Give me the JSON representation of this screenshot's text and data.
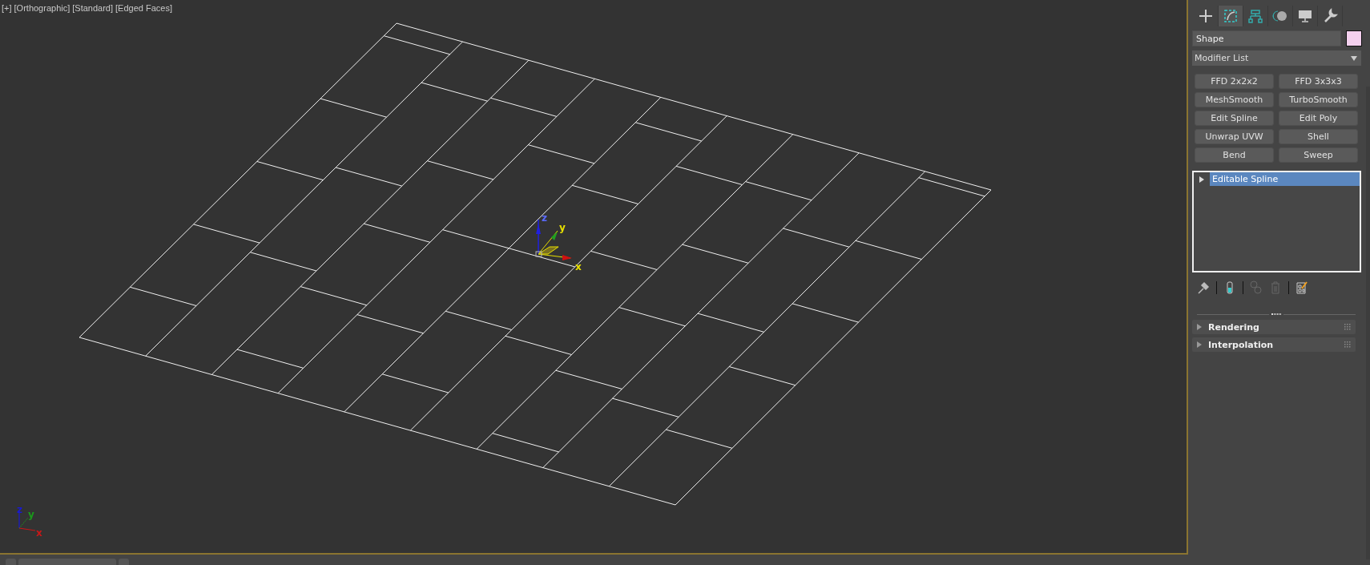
{
  "viewport": {
    "labels": [
      {
        "text": "[+]"
      },
      {
        "text": "[Orthographic]"
      },
      {
        "text": "[Standard]"
      },
      {
        "text": "[Edged Faces]"
      }
    ],
    "gizmo_axes": [
      {
        "label": "z",
        "color": "#5a6aff"
      },
      {
        "label": "y",
        "color": "#e8e000"
      },
      {
        "label": "x",
        "color": "#e8e000"
      }
    ],
    "corner_axes": [
      {
        "label": "z",
        "color": "#1a1ad0"
      },
      {
        "label": "y",
        "color": "#1a9a1a"
      },
      {
        "label": "x",
        "color": "#c81818"
      }
    ]
  },
  "command_panel": {
    "tabs": [
      {
        "kind": "create",
        "selected": false
      },
      {
        "kind": "modify",
        "selected": true
      },
      {
        "kind": "hierarchy",
        "selected": false
      },
      {
        "kind": "motion",
        "selected": false
      },
      {
        "kind": "display",
        "selected": false
      },
      {
        "kind": "utilities",
        "selected": false
      }
    ],
    "object": {
      "name": "Shape",
      "color": "#f4d0ee"
    },
    "modifier_list": "Modifier List",
    "modifier_buttons": [
      "FFD 2x2x2",
      "FFD 3x3x3",
      "MeshSmooth",
      "TurboSmooth",
      "Edit Spline",
      "Edit Poly",
      "Unwrap UVW",
      "Shell",
      "Bend",
      "Sweep"
    ],
    "stack": [
      {
        "label": "Editable Spline",
        "selected": true
      }
    ],
    "rollouts": [
      {
        "label": "Rendering",
        "expanded": false
      },
      {
        "label": "Interpolation",
        "expanded": false
      }
    ]
  }
}
